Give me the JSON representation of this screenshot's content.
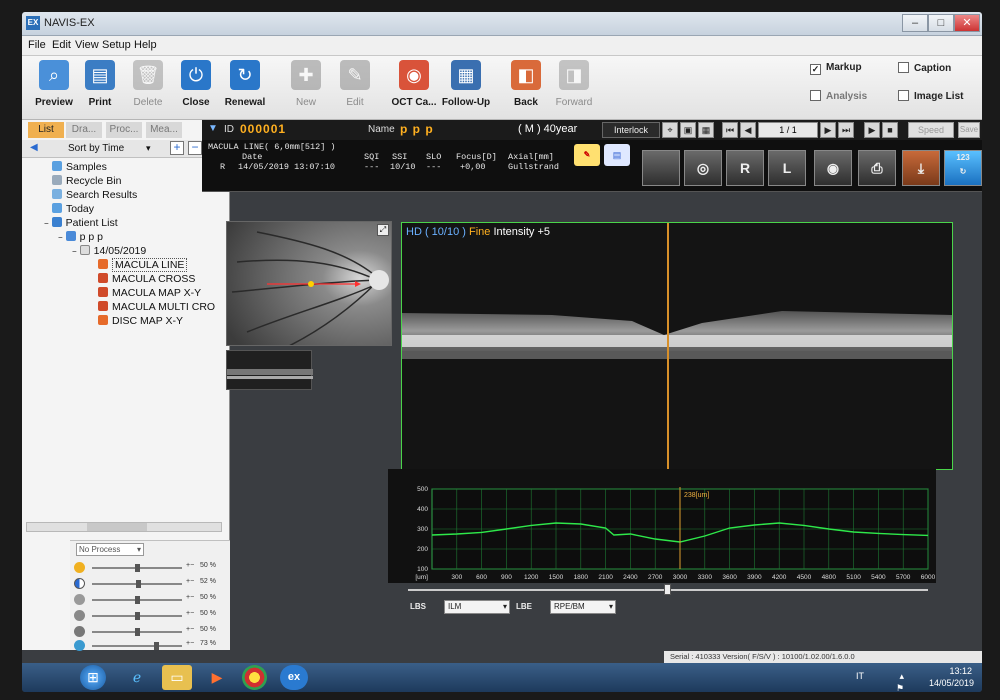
{
  "window": {
    "title": "NAVIS-EX",
    "icon_text": "EX"
  },
  "menu": [
    "File",
    "Edit",
    "View",
    "Setup",
    "Help"
  ],
  "toolbar": {
    "buttons": [
      {
        "label": "Preview",
        "icon": "magnifier-icon",
        "enabled": true
      },
      {
        "label": "Print",
        "icon": "printer-icon",
        "enabled": true
      },
      {
        "label": "Delete",
        "icon": "trash-icon",
        "enabled": false
      },
      {
        "label": "Close",
        "icon": "power-icon",
        "enabled": true
      },
      {
        "label": "Renewal",
        "icon": "refresh-icon",
        "enabled": true
      },
      {
        "label": "New",
        "icon": "new-document-icon",
        "enabled": false
      },
      {
        "label": "Edit",
        "icon": "edit-document-icon",
        "enabled": false
      },
      {
        "label": "OCT Ca...",
        "icon": "oct-camera-icon",
        "enabled": true
      },
      {
        "label": "Follow-Up",
        "icon": "follow-up-icon",
        "enabled": true
      },
      {
        "label": "Back",
        "icon": "back-icon",
        "enabled": true
      },
      {
        "label": "Forward",
        "icon": "forward-icon",
        "enabled": false
      }
    ],
    "checkboxes": [
      {
        "label": "Markup",
        "checked": true
      },
      {
        "label": "Caption",
        "checked": false
      },
      {
        "label": "Analysis",
        "checked": false
      },
      {
        "label": "Image List",
        "checked": false
      }
    ]
  },
  "left": {
    "tabs": [
      "List",
      "Dra...",
      "Proc...",
      "Mea..."
    ],
    "sort_label": "Sort by Time",
    "tree": [
      {
        "label": "Samples",
        "indent": 0
      },
      {
        "label": "Recycle Bin",
        "indent": 0
      },
      {
        "label": "Search Results",
        "indent": 0
      },
      {
        "label": "Today",
        "indent": 0
      },
      {
        "label": "Patient List",
        "indent": 0
      },
      {
        "label": "p p p",
        "indent": 1
      },
      {
        "label": "14/05/2019",
        "indent": 2
      },
      {
        "label": "MACULA LINE",
        "indent": 3
      },
      {
        "label": "MACULA CROSS",
        "indent": 3
      },
      {
        "label": "MACULA MAP X-Y",
        "indent": 3
      },
      {
        "label": "MACULA MULTI CRO",
        "indent": 3
      },
      {
        "label": "DISC MAP X-Y",
        "indent": 3
      }
    ],
    "process": {
      "select": "No Process",
      "sliders": [
        {
          "icon": "brightness-icon",
          "value": 0.5,
          "pct": "50 %"
        },
        {
          "icon": "contrast-icon",
          "value": 0.52,
          "pct": "52 %"
        },
        {
          "icon": "gamma-icon",
          "value": 0.5,
          "pct": "50 %"
        },
        {
          "icon": "sharpness-icon",
          "value": 0.5,
          "pct": "50 %"
        },
        {
          "icon": "noise-icon",
          "value": 0.5,
          "pct": "50 %"
        },
        {
          "icon": "color-icon",
          "value": 0.73,
          "pct": "73 %"
        }
      ]
    }
  },
  "patient": {
    "id_label": "ID",
    "id": "000001",
    "name_label": "Name",
    "name": "p p p",
    "sex_age": "( M ) 40year",
    "interlock": "Interlock",
    "page": "1 / 1",
    "speed": "Speed",
    "save": "Save"
  },
  "info": {
    "exam": "MACULA LINE( 6,0mm[512] )",
    "headers": {
      "date": "Date",
      "sqi": "SQI",
      "ssi": "SSI",
      "slo": "SLO",
      "focus": "Focus[D]",
      "axial": "Axial[mm]"
    },
    "eye": "R",
    "date": "14/05/2019 13:07:10",
    "sqi": "---",
    "ssi": "10/10",
    "slo": "---",
    "focus": "+0,00",
    "axial": "Gullstrand",
    "view_buttons": [
      "",
      "",
      "R",
      "L",
      "",
      "",
      "",
      "123"
    ]
  },
  "oct": {
    "hd": "HD ( 10/10 )",
    "fine": "Fine",
    "intensity": "Intensity +5"
  },
  "chart_data": {
    "type": "line",
    "cursor_label": "238[um]",
    "cursor_x": 3000,
    "xlabel_unit": "[um]",
    "xlim": [
      0,
      6000
    ],
    "ylim": [
      100,
      500
    ],
    "x_ticks": [
      300,
      600,
      900,
      1200,
      1500,
      1800,
      2100,
      2400,
      2700,
      3000,
      3300,
      3600,
      3900,
      4200,
      4500,
      4800,
      5100,
      5400,
      5700,
      6000
    ],
    "y_ticks": [
      100,
      200,
      300,
      400,
      500
    ],
    "x": [
      0,
      300,
      600,
      900,
      1200,
      1500,
      1800,
      2100,
      2200,
      2400,
      2700,
      3000,
      3300,
      3600,
      3900,
      4200,
      4500,
      4800,
      5100,
      5400,
      5700,
      6000
    ],
    "y": [
      270,
      275,
      283,
      300,
      318,
      330,
      325,
      305,
      270,
      275,
      250,
      235,
      265,
      305,
      320,
      330,
      318,
      300,
      285,
      278,
      272,
      268
    ],
    "grid": true,
    "line_color": "#2ee84a"
  },
  "bottom": {
    "lbs_label": "LBS",
    "lbs_value": "ILM",
    "lbe_label": "LBE",
    "lbe_value": "RPE/BM"
  },
  "status": "Serial : 410333     Version( F/S/V ) : 10100/1.02.00/1.6.0.0",
  "tray": {
    "lang": "IT",
    "time": "13:12",
    "date": "14/05/2019"
  }
}
